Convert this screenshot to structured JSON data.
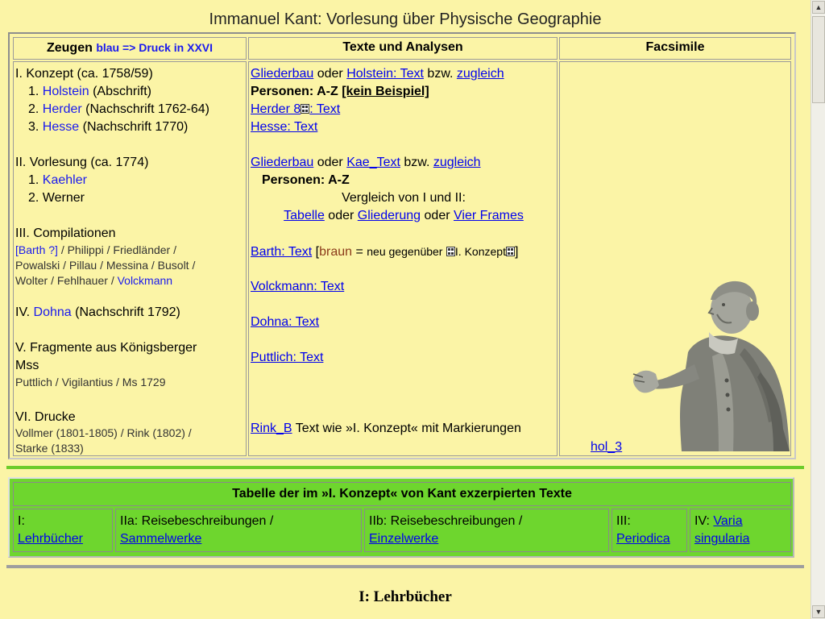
{
  "title": "Immanuel Kant: Vorlesung über Physische Geographie",
  "headers": {
    "zeugen_label": "Zeugen",
    "zeugen_note": "blau => Druck in XXVI",
    "texte": "Texte und Analysen",
    "facsimile": "Facsimile"
  },
  "col1": {
    "s1_title": "I. Konzept (ca. 1758/59)",
    "s1_items": [
      {
        "num": "1.",
        "name": "Holstein",
        "note": "(Abschrift)"
      },
      {
        "num": "2.",
        "name": "Herder",
        "note": "(Nachschrift 1762-64)"
      },
      {
        "num": "3.",
        "name": "Hesse",
        "note": "(Nachschrift 1770)"
      }
    ],
    "s2_title": "II. Vorlesung (ca. 1774)",
    "s2_items": [
      {
        "num": "1.",
        "name": "Kaehler"
      },
      {
        "num": "2.",
        "name": "Werner"
      }
    ],
    "s3_title": "III. Compilationen",
    "s3_barth": "[Barth ?]",
    "s3_philippi": "Philippi",
    "s3_friedlaender": "Friedländer",
    "s3_powalski": "Powalski",
    "s3_pillau": "Pillau",
    "s3_messina": "Messina",
    "s3_busolt": "Busolt",
    "s3_wolter": "Wolter",
    "s3_fehlhauer": "Fehlhauer",
    "s3_volckmann": "Volckmann",
    "sep": "/",
    "s4_prefix": "IV.",
    "s4_name": "Dohna",
    "s4_note": "(Nachschrift 1792)",
    "s5_title1": "V. Fragmente aus Königsberger",
    "s5_title2": "Mss",
    "s5_items": "Puttlich / Vigilantius / Ms 1729",
    "s6_title": "VI. Drucke",
    "s6_vollmer": "Vollmer (1801-1805)",
    "s6_rink": "Rink (1802)",
    "s6_starke": "Starke (1833)"
  },
  "col2": {
    "gliederbau": "Gliederbau",
    "oder": "oder",
    "holstein_text": "Holstein: Text",
    "bzw": "bzw.",
    "zugleich": "zugleich",
    "personen_az": "Personen: A-Z",
    "kein_beispiel": "[kein Beispiel]",
    "herder_8": "Herder 8",
    "herder_text": ": Text",
    "hesse_text": "Hesse: Text",
    "kae_text": "Kae_Text",
    "vergleich": "Vergleich von I und II:",
    "tabelle": "Tabelle",
    "gliederung": "Gliederung",
    "vier_frames": "Vier Frames",
    "barth_text": "Barth: Text",
    "braun": "braun",
    "equals": "=",
    "neu_gegenueber": "neu gegenüber",
    "i_konzept": "I. Konzept",
    "volckmann_text": "Volckmann: Text",
    "dohna_text": "Dohna: Text",
    "puttlich_text": "Puttlich: Text",
    "rink_b": "Rink_B",
    "rink_note": "Text wie »I. Konzept« mit Markierungen"
  },
  "col3": {
    "hol_3": "hol_3"
  },
  "green_table": {
    "heading": "Tabelle der im »I. Konzept« von Kant exzerpierten Texte",
    "cells": [
      {
        "prefix": "I:",
        "link": "Lehrbücher"
      },
      {
        "prefix": "IIa: Reisebeschreibungen /",
        "link": "Sammelwerke"
      },
      {
        "prefix": "IIb: Reisebeschreibungen /",
        "link": "Einzelwerke"
      },
      {
        "prefix": "III:",
        "link": "Periodica"
      },
      {
        "prefix": "IV:",
        "link": "Varia",
        "link2": "singularia"
      }
    ]
  },
  "section_title": "I: Lehrbücher",
  "icons": {
    "ff_icon": "ff-frame-icon",
    "statue": "kant-statue-icon"
  },
  "colors": {
    "background": "#fbf4a6",
    "green": "#6ed62e",
    "link": "#0000ee",
    "brown": "#8b3a1a"
  }
}
